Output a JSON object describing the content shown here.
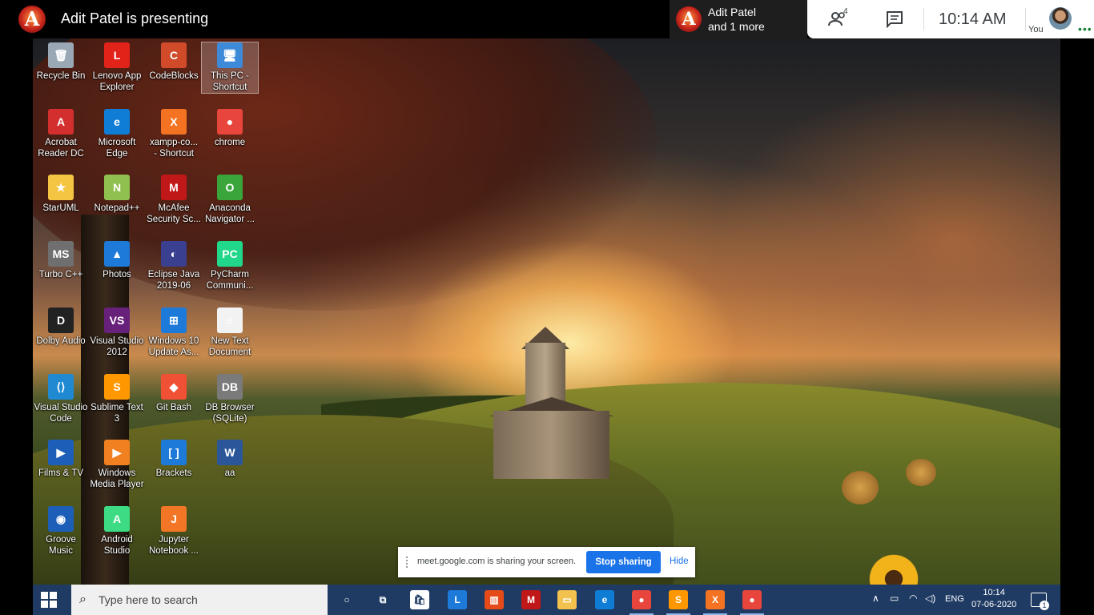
{
  "meet": {
    "presenter_logo_letter": "A",
    "presenting_text": "Adit Patel is presenting",
    "tile_line1": "Adit Patel",
    "tile_line2": "and 1 more",
    "participants_count": "4",
    "time": "10:14  AM",
    "you_label": "You"
  },
  "desktop_icons": [
    {
      "label1": "Recycle Bin",
      "label2": "",
      "icon": "recycle-bin-icon",
      "color": "#9aa7b4",
      "glyph": "🗑"
    },
    {
      "label1": "Lenovo App",
      "label2": "Explorer",
      "icon": "lenovo-app-explorer-icon",
      "color": "#e2231a",
      "glyph": "L"
    },
    {
      "label1": "CodeBlocks",
      "label2": "",
      "icon": "codeblocks-icon",
      "color": "#d14b2b",
      "glyph": "C"
    },
    {
      "label1": "This PC -",
      "label2": "Shortcut",
      "icon": "this-pc-icon",
      "color": "#3c8ad8",
      "glyph": "🖥",
      "selected": true
    },
    {
      "label1": "Acrobat",
      "label2": "Reader DC",
      "icon": "acrobat-icon",
      "color": "#d32f2f",
      "glyph": "A"
    },
    {
      "label1": "Microsoft",
      "label2": "Edge",
      "icon": "edge-icon",
      "color": "#0f7dd6",
      "glyph": "e"
    },
    {
      "label1": "xampp-co...",
      "label2": "- Shortcut",
      "icon": "xampp-icon",
      "color": "#f37323",
      "glyph": "X"
    },
    {
      "label1": "chrome",
      "label2": "",
      "icon": "chrome-icon",
      "color": "#e8453c",
      "glyph": "●"
    },
    {
      "label1": "StarUML",
      "label2": "",
      "icon": "staruml-icon",
      "color": "#f4c542",
      "glyph": "★"
    },
    {
      "label1": "Notepad++",
      "label2": "",
      "icon": "notepadpp-icon",
      "color": "#90c050",
      "glyph": "N"
    },
    {
      "label1": "McAfee",
      "label2": "Security Sc...",
      "icon": "mcafee-icon",
      "color": "#c01818",
      "glyph": "M"
    },
    {
      "label1": "Anaconda",
      "label2": "Navigator ...",
      "icon": "anaconda-icon",
      "color": "#3aa53a",
      "glyph": "O"
    },
    {
      "label1": "Turbo C++",
      "label2": "",
      "icon": "turbo-cpp-icon",
      "color": "#6f6f6f",
      "glyph": "MS"
    },
    {
      "label1": "Photos",
      "label2": "",
      "icon": "photos-icon",
      "color": "#1d7ad8",
      "glyph": "▲"
    },
    {
      "label1": "Eclipse Java",
      "label2": "2019-06",
      "icon": "eclipse-icon",
      "color": "#3b3f8f",
      "glyph": "◐"
    },
    {
      "label1": "PyCharm",
      "label2": "Communi...",
      "icon": "pycharm-icon",
      "color": "#21d789",
      "glyph": "PC"
    },
    {
      "label1": "Dolby Audio",
      "label2": "",
      "icon": "dolby-icon",
      "color": "#222222",
      "glyph": "D"
    },
    {
      "label1": "Visual Studio",
      "label2": "2012",
      "icon": "visual-studio-icon",
      "color": "#68217a",
      "glyph": "VS"
    },
    {
      "label1": "Windows 10",
      "label2": "Update As...",
      "icon": "windows-update-icon",
      "color": "#1d7ad8",
      "glyph": "⊞"
    },
    {
      "label1": "New Text",
      "label2": "Document",
      "icon": "text-document-icon",
      "color": "#f2f2f2",
      "glyph": "≡"
    },
    {
      "label1": "Visual Studio",
      "label2": "Code",
      "icon": "vscode-icon",
      "color": "#1f8ad2",
      "glyph": "⟨⟩"
    },
    {
      "label1": "Sublime Text",
      "label2": "3",
      "icon": "sublime-icon",
      "color": "#ff9800",
      "glyph": "S"
    },
    {
      "label1": "Git Bash",
      "label2": "",
      "icon": "git-bash-icon",
      "color": "#f05033",
      "glyph": "◆"
    },
    {
      "label1": "DB Browser",
      "label2": "(SQLite)",
      "icon": "db-browser-icon",
      "color": "#7a7a7a",
      "glyph": "DB"
    },
    {
      "label1": "Films & TV",
      "label2": "",
      "icon": "films-tv-icon",
      "color": "#1d5fb8",
      "glyph": "▶"
    },
    {
      "label1": "Windows",
      "label2": "Media Player",
      "icon": "media-player-icon",
      "color": "#f08020",
      "glyph": "▶"
    },
    {
      "label1": "Brackets",
      "label2": "",
      "icon": "brackets-icon",
      "color": "#1d7ad8",
      "glyph": "[ ]"
    },
    {
      "label1": "aa",
      "label2": "",
      "icon": "word-doc-icon",
      "color": "#2b579a",
      "glyph": "W"
    },
    {
      "label1": "Groove",
      "label2": "Music",
      "icon": "groove-icon",
      "color": "#1d5fb8",
      "glyph": "◉"
    },
    {
      "label1": "Android",
      "label2": "Studio",
      "icon": "android-studio-icon",
      "color": "#3ddc84",
      "glyph": "A"
    },
    {
      "label1": "Jupyter",
      "label2": "Notebook ...",
      "icon": "jupyter-icon",
      "color": "#f37626",
      "glyph": "J"
    }
  ],
  "share_bar": {
    "text": "meet.google.com is sharing your screen.",
    "stop_label": "Stop sharing",
    "hide_label": "Hide"
  },
  "taskbar": {
    "search_placeholder": "Type here to search",
    "apps": [
      {
        "icon": "cortana-icon",
        "color": "transparent",
        "glyph": "○"
      },
      {
        "icon": "task-view-icon",
        "color": "transparent",
        "glyph": "⧉"
      },
      {
        "icon": "store-icon",
        "color": "#ffffff",
        "glyph": "🛍"
      },
      {
        "icon": "lenovo-app-icon",
        "color": "#1d7ad8",
        "glyph": "L"
      },
      {
        "icon": "office-icon",
        "color": "#e64a19",
        "glyph": "▥"
      },
      {
        "icon": "mcafee-taskbar-icon",
        "color": "#c01818",
        "glyph": "M"
      },
      {
        "icon": "file-explorer-icon",
        "color": "#f2c14e",
        "glyph": "▭"
      },
      {
        "icon": "edge-taskbar-icon",
        "color": "#0f7dd6",
        "glyph": "e"
      },
      {
        "icon": "chrome-taskbar-icon",
        "color": "#e8453c",
        "glyph": "●"
      },
      {
        "icon": "sublime-taskbar-icon",
        "color": "#ff9800",
        "glyph": "S"
      },
      {
        "icon": "xampp-taskbar-icon",
        "color": "#f37323",
        "glyph": "X"
      },
      {
        "icon": "chrome2-taskbar-icon",
        "color": "#e8453c",
        "glyph": "●"
      }
    ],
    "language": "ENG",
    "time": "10:14",
    "date": "07-06-2020",
    "notifications": "1"
  }
}
